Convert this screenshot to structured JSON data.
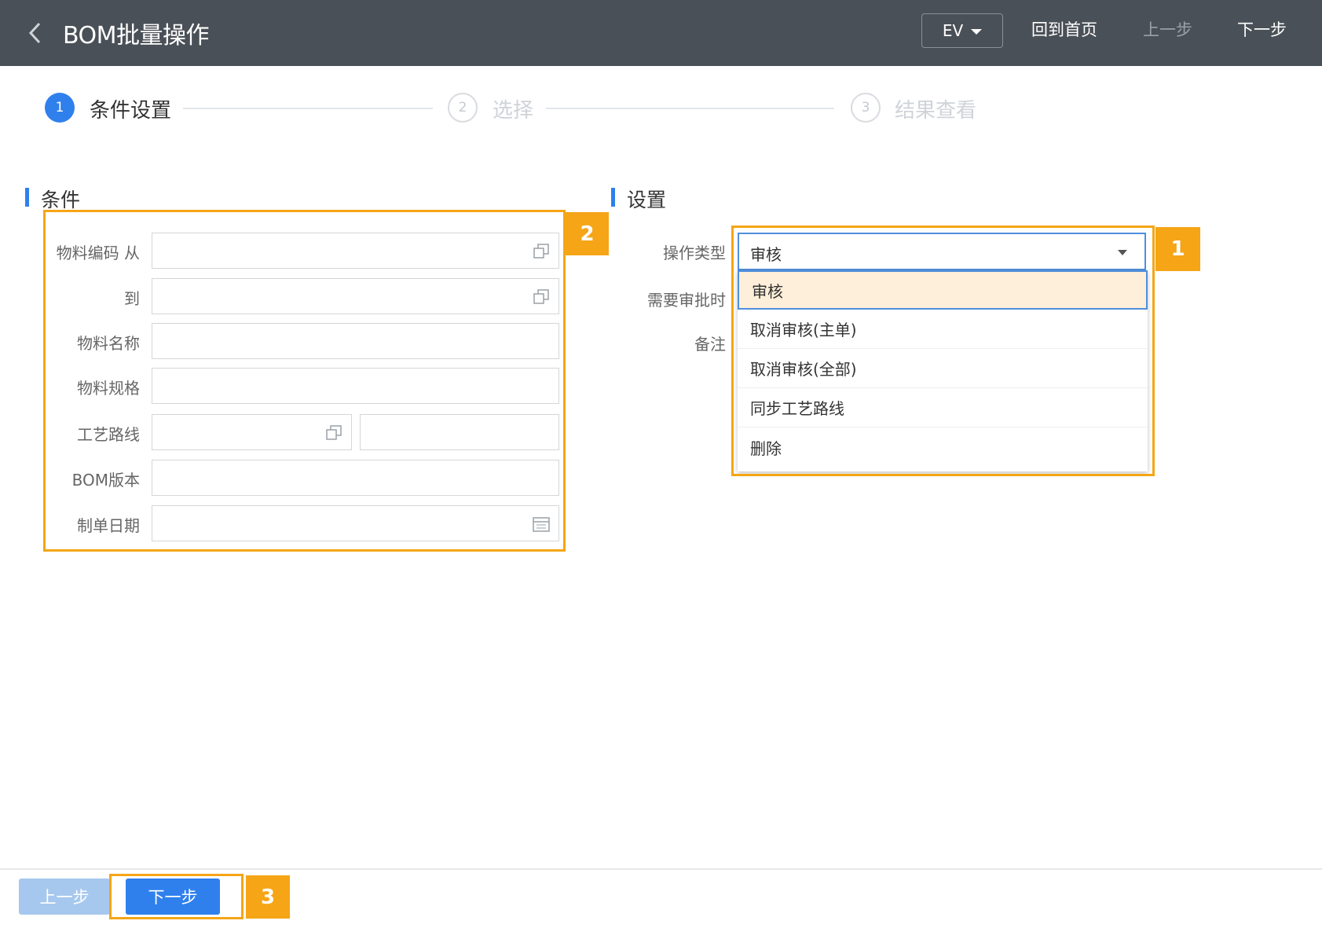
{
  "header": {
    "title": "BOM批量操作",
    "language": "EV",
    "home_link": "回到首页",
    "prev_link": "上一步",
    "next_link": "下一步"
  },
  "stepper": {
    "steps": [
      {
        "number": "1",
        "label": "条件设置",
        "state": "active"
      },
      {
        "number": "2",
        "label": "选择",
        "state": "inactive"
      },
      {
        "number": "3",
        "label": "结果查看",
        "state": "inactive"
      }
    ]
  },
  "conditions": {
    "title": "条件",
    "fields": [
      {
        "label": "物料编码 从",
        "value": ""
      },
      {
        "label": "到",
        "value": ""
      },
      {
        "label": "物料名称",
        "value": ""
      },
      {
        "label": "物料规格",
        "value": ""
      },
      {
        "label": "工艺路线",
        "value": ""
      },
      {
        "label": "BOM版本",
        "value": ""
      },
      {
        "label": "制单日期",
        "value": ""
      }
    ]
  },
  "settings": {
    "title": "设置",
    "op_type_label": "操作类型",
    "approval_label": "需要审批时",
    "remark_label": "备注",
    "op_type_value": "审核",
    "options": [
      "审核",
      "取消审核(主单)",
      "取消审核(全部)",
      "同步工艺路线",
      "删除"
    ]
  },
  "badges": {
    "one": "1",
    "two": "2",
    "three": "3"
  },
  "footer": {
    "prev_button": "上一步",
    "next_button": "下一步"
  },
  "colors": {
    "header_bg": "#4a5057",
    "accent": "#2f80ed",
    "highlight": "#f5a516",
    "selected_option_bg": "#fdefd9"
  }
}
